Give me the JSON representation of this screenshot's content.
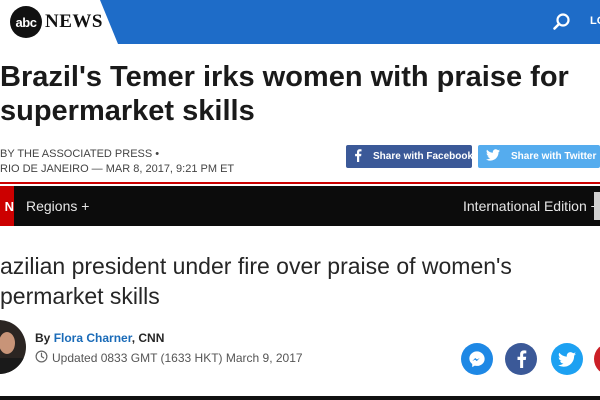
{
  "abc": {
    "logo_abc": "abc",
    "logo_news": "NEWS",
    "login_label": "LO",
    "headline_line1": "Brazil's Temer irks women with praise for",
    "headline_line2": "supermarket skills",
    "byline": "By THE ASSOCIATED PRESS  •",
    "dateline": "RIO DE JANEIRO — Mar 8, 2017, 9:21 PM ET",
    "share_facebook": "Share with Facebook",
    "share_twitter": "Share with Twitter",
    "colors": {
      "header_blue": "#1e6cc8",
      "facebook": "#3b5998",
      "twitter": "#55acee"
    }
  },
  "cnn": {
    "logo_text": "N",
    "nav_regions": "Regions +",
    "nav_edition": "International Edition +",
    "headline_line1": "azilian president under fire over praise of women's",
    "headline_line2": "permarket skills",
    "byline_by": "By ",
    "author": "Flora Charner",
    "org": ", CNN",
    "updated": "Updated 0833 GMT (1633 HKT) March 9, 2017",
    "share_icons": [
      "messenger-icon",
      "facebook-icon",
      "twitter-icon",
      "pinterest-icon"
    ],
    "colors": {
      "brand_red": "#cc0000",
      "author_link": "#1a6bb8"
    }
  }
}
